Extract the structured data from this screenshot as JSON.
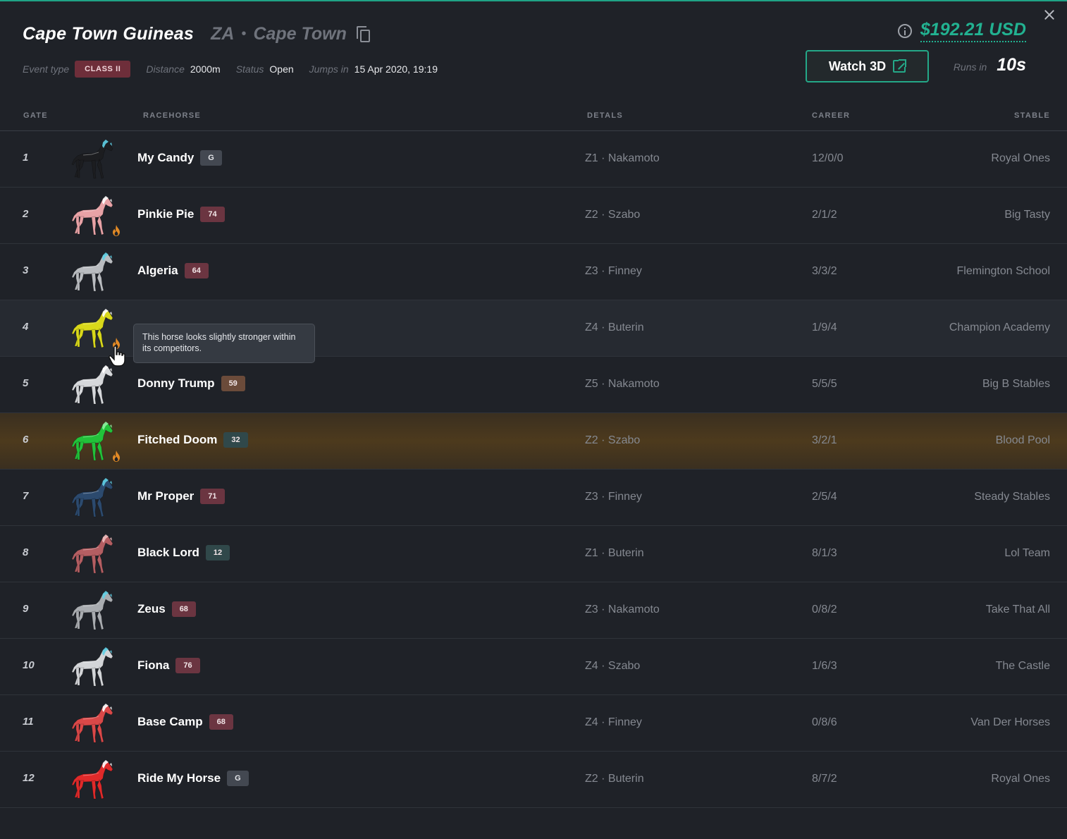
{
  "event": {
    "title": "Cape Town Guineas",
    "country": "ZA",
    "separator": "•",
    "city": "Cape Town",
    "prize": "$192.21 USD",
    "meta": {
      "event_type_label": "Event type",
      "class_badge": "CLASS II",
      "distance_label": "Distance",
      "distance_value": "2000m",
      "status_label": "Status",
      "status_value": "Open",
      "jumps_label": "Jumps in",
      "jumps_value": "15 Apr 2020, 19:19"
    },
    "watch_label": "Watch 3D",
    "runs_label": "Runs in",
    "runs_value": "10s"
  },
  "columns": {
    "gate": "GATE",
    "racehorse": "RACEHORSE",
    "details": "DETALS",
    "career": "CAREER",
    "stable": "STABLE"
  },
  "tooltip": "This horse looks slightly stronger within its competitors.",
  "rows": [
    {
      "gate": "1",
      "name": "My Candy",
      "rating": "G",
      "rating_style": "gray",
      "color": "#1c1d20",
      "mane": "#5fd0e6",
      "flame": false,
      "details": "Z1 · Nakamoto",
      "career": "12/0/0",
      "stable": "Royal Ones"
    },
    {
      "gate": "2",
      "name": "Pinkie Pie",
      "rating": "74",
      "rating_style": "red",
      "color": "#e8a2a6",
      "mane": "#ffffff",
      "flame": true,
      "details": "Z2 · Szabo",
      "career": "2/1/2",
      "stable": "Big Tasty"
    },
    {
      "gate": "3",
      "name": "Algeria",
      "rating": "64",
      "rating_style": "red",
      "color": "#b9bcc0",
      "mane": "#5fd0e6",
      "flame": false,
      "details": "Z3 · Finney",
      "career": "3/3/2",
      "stable": "Flemington School"
    },
    {
      "gate": "4",
      "name": "",
      "rating": "",
      "rating_style": "red",
      "color": "#d9d81a",
      "mane": "#ffffff",
      "flame": true,
      "details": "Z4 · Buterin",
      "career": "1/9/4",
      "stable": "Champion Academy"
    },
    {
      "gate": "5",
      "name": "Donny Trump",
      "rating": "59",
      "rating_style": "brown",
      "color": "#d6d8db",
      "mane": "#ffffff",
      "flame": false,
      "details": "Z5 · Nakamoto",
      "career": "5/5/5",
      "stable": "Big B Stables"
    },
    {
      "gate": "6",
      "name": "Fitched Doom",
      "rating": "32",
      "rating_style": "teal",
      "color": "#22c23a",
      "mane": "#8ff0a0",
      "flame": true,
      "details": "Z2 · Szabo",
      "career": "3/2/1",
      "stable": "Blood Pool"
    },
    {
      "gate": "7",
      "name": "Mr Proper",
      "rating": "71",
      "rating_style": "red",
      "color": "#2c4a6e",
      "mane": "#5fd0e6",
      "flame": false,
      "details": "Z3 · Finney",
      "career": "2/5/4",
      "stable": "Steady Stables"
    },
    {
      "gate": "8",
      "name": "Black Lord",
      "rating": "12",
      "rating_style": "teal",
      "color": "#b45e62",
      "mane": "#f0c0c0",
      "flame": false,
      "details": "Z1 · Buterin",
      "career": "8/1/3",
      "stable": "Lol Team"
    },
    {
      "gate": "9",
      "name": "Zeus",
      "rating": "68",
      "rating_style": "red",
      "color": "#a9acb0",
      "mane": "#5fd0e6",
      "flame": false,
      "details": "Z3 · Nakamoto",
      "career": "0/8/2",
      "stable": "Take That All"
    },
    {
      "gate": "10",
      "name": "Fiona",
      "rating": "76",
      "rating_style": "red",
      "color": "#d3d5d8",
      "mane": "#5fd0e6",
      "flame": false,
      "details": "Z4 · Szabo",
      "career": "1/6/3",
      "stable": "The Castle"
    },
    {
      "gate": "11",
      "name": "Base Camp",
      "rating": "68",
      "rating_style": "red",
      "color": "#d94848",
      "mane": "#ffffff",
      "flame": false,
      "details": "Z4 · Finney",
      "career": "0/8/6",
      "stable": "Van Der Horses"
    },
    {
      "gate": "12",
      "name": "Ride My Horse",
      "rating": "G",
      "rating_style": "gray",
      "color": "#e02a2a",
      "mane": "#ffffff",
      "flame": false,
      "details": "Z2 · Buterin",
      "career": "8/7/2",
      "stable": "Royal Ones"
    }
  ]
}
